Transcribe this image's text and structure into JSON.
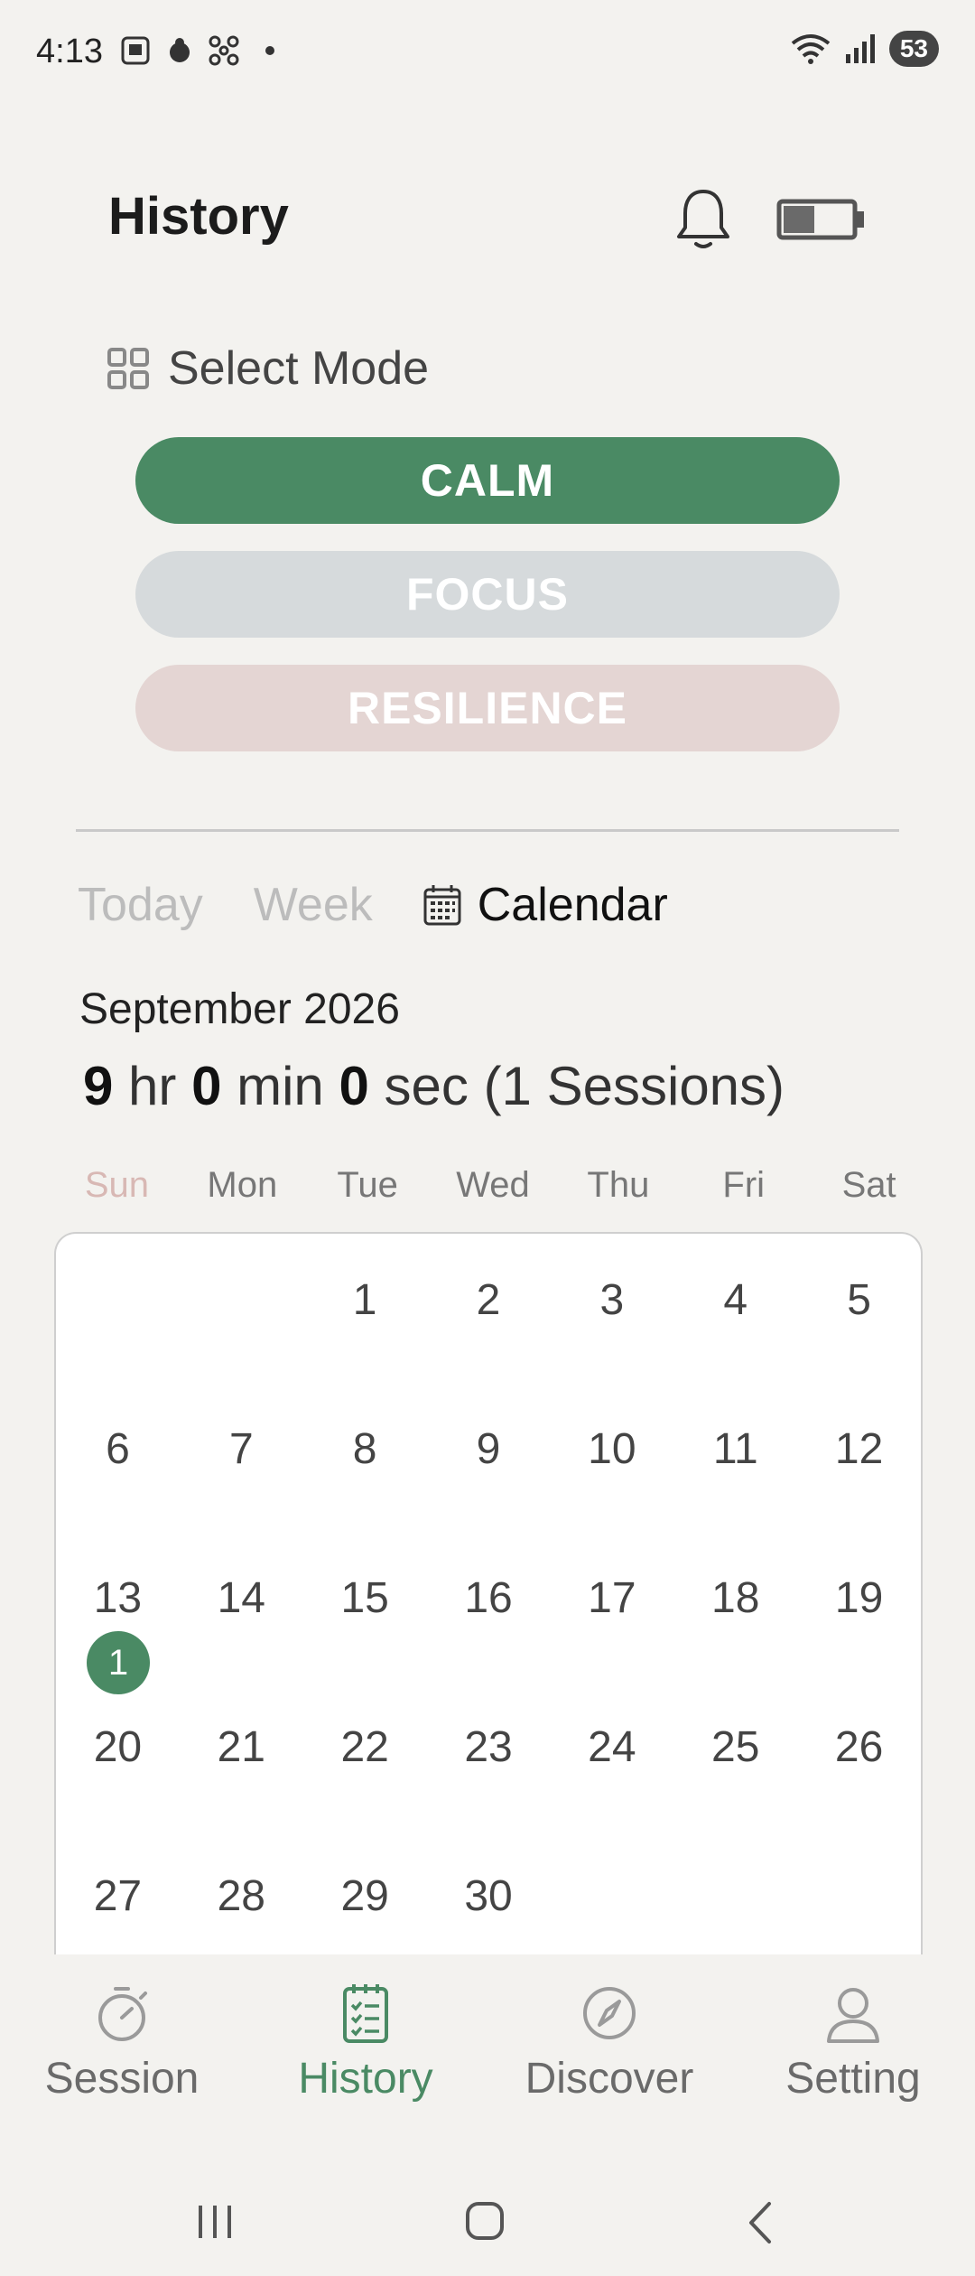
{
  "status_bar": {
    "time": "4:13",
    "battery_level": "53",
    "left_icons": [
      "screenshot-icon",
      "app-icon",
      "fan-icon",
      "dot-icon"
    ],
    "right_icons": [
      "wifi-icon",
      "signal-icon",
      "battery-icon"
    ]
  },
  "header": {
    "title": "History",
    "bell_icon": "bell-icon",
    "device_battery_icon": "device-battery-icon"
  },
  "mode": {
    "select_label": "Select Mode",
    "options": [
      {
        "label": "CALM",
        "color": "#4a8a64",
        "selected": true
      },
      {
        "label": "FOCUS",
        "color": "#d6dadc",
        "selected": false
      },
      {
        "label": "RESILIENCE",
        "color": "#e4d5d3",
        "selected": false
      }
    ]
  },
  "tabs": {
    "today": "Today",
    "week": "Week",
    "calendar": "Calendar",
    "active": "Calendar"
  },
  "summary": {
    "month": "September 2026",
    "hours": "9",
    "hr_unit": "hr",
    "minutes": "0",
    "min_unit": "min",
    "seconds": "0",
    "sec_unit": "sec",
    "sessions": "(1 Sessions)"
  },
  "calendar": {
    "weekdays": [
      "Sun",
      "Mon",
      "Tue",
      "Wed",
      "Thu",
      "Fri",
      "Sat"
    ],
    "weeks": [
      [
        "",
        "",
        "1",
        "2",
        "3",
        "4",
        "5"
      ],
      [
        "6",
        "7",
        "8",
        "9",
        "10",
        "11",
        "12"
      ],
      [
        "13",
        "14",
        "15",
        "16",
        "17",
        "18",
        "19"
      ],
      [
        "20",
        "21",
        "22",
        "23",
        "24",
        "25",
        "26"
      ],
      [
        "27",
        "28",
        "29",
        "30",
        "",
        "",
        ""
      ]
    ],
    "session_marker": {
      "day": "13",
      "count": "1",
      "color": "#4a8a64"
    }
  },
  "bottom_nav": {
    "items": [
      {
        "label": "Session",
        "icon": "stopwatch-icon"
      },
      {
        "label": "History",
        "icon": "clipboard-checklist-icon"
      },
      {
        "label": "Discover",
        "icon": "compass-icon"
      },
      {
        "label": "Setting",
        "icon": "user-icon"
      }
    ],
    "active": "History"
  },
  "colors": {
    "accent": "#4a8a64",
    "background": "#f3f2ef"
  }
}
